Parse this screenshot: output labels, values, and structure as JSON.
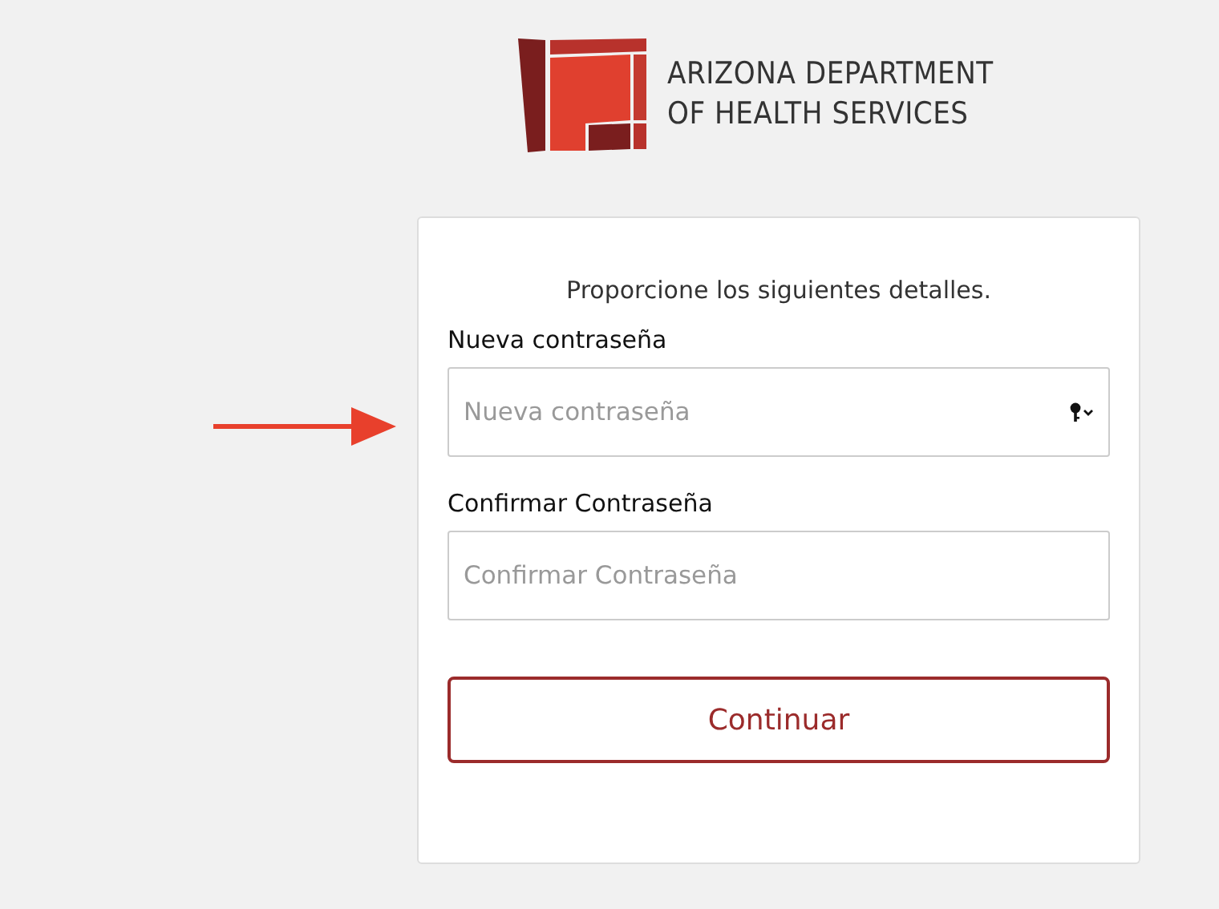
{
  "logo": {
    "lines": [
      "ARIZONA DEPARTMENT",
      "OF HEALTH SERVICES"
    ]
  },
  "form": {
    "intro": "Proporcione los siguientes detalles.",
    "fields": [
      {
        "label": "Nueva contraseña",
        "placeholder": "Nueva contraseña",
        "kind": "password-manager"
      },
      {
        "label": "Confirmar Contraseña",
        "placeholder": "Confirmar Contraseña",
        "kind": "plain"
      }
    ],
    "button": "Continuar"
  }
}
